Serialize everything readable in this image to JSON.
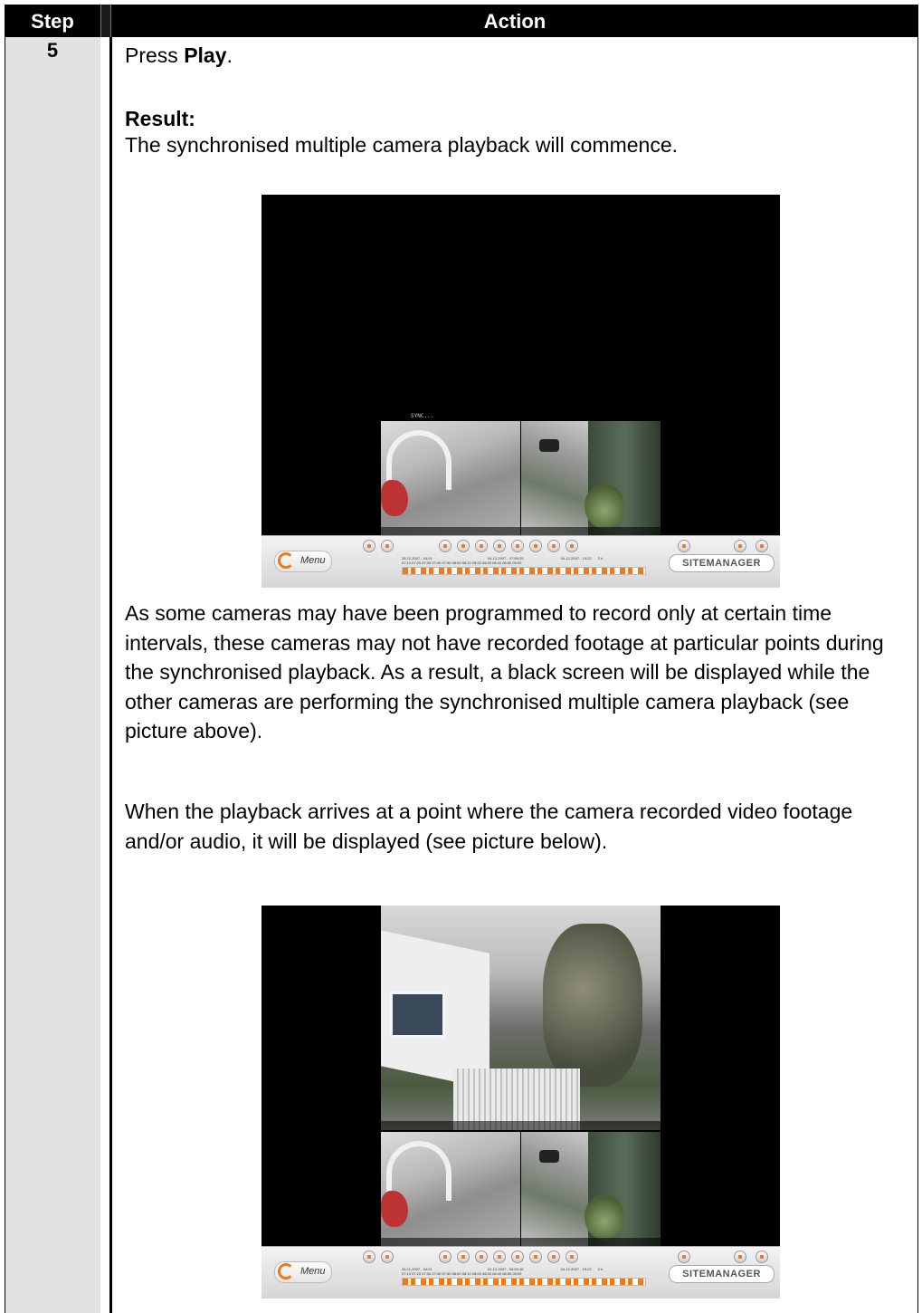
{
  "table": {
    "header_step": "Step",
    "header_action": "Action",
    "step_number": "5"
  },
  "content": {
    "press_prefix": "Press ",
    "press_bold": "Play",
    "press_suffix": ".",
    "result_label": "Result:",
    "result_text": "The synchronised multiple camera playback will commence.",
    "note_paragraph": "As some cameras may have been programmed to record only at certain time intervals, these cameras may not have recorded footage at particular points during the synchronised playback.  As a result, a black screen will be displayed while the other cameras are performing the synchronised multiple camera playback (see picture above).",
    "when_paragraph": "When the playback arrives at a point where the camera recorded video footage and/or audio, it will be displayed (see picture below)."
  },
  "screenshot_1": {
    "sync_label": "SYNC...",
    "timeline_start": "28-11-2007 - 04:01",
    "timeline_current": "04-12-2007 - 07:59:25",
    "timeline_end": "04-12-2007 - 19:22",
    "timeline_span": "2 h",
    "timeline_ticks": "07:10  07:20  07:30  07:40  07:50  08:00  08:10  08:20  08:30  08:40  08:50  09:00"
  },
  "screenshot_2": {
    "timeline_start": "28-11-2007 - 04:01",
    "timeline_current": "04-12-2007 - 08:00:18",
    "timeline_end": "04-12-2007 - 19:22",
    "timeline_span": "2 h",
    "timeline_ticks": "07:10  07:20  07:30  07:40  07:50  08:00  08:10  08:20  08:30  08:40  08:50  09:00"
  },
  "controls": {
    "menu_label": "Menu",
    "brand_text": "SITEMANAGER",
    "accent_color": "#f07a1a",
    "brand_color": "#d01c1c"
  }
}
